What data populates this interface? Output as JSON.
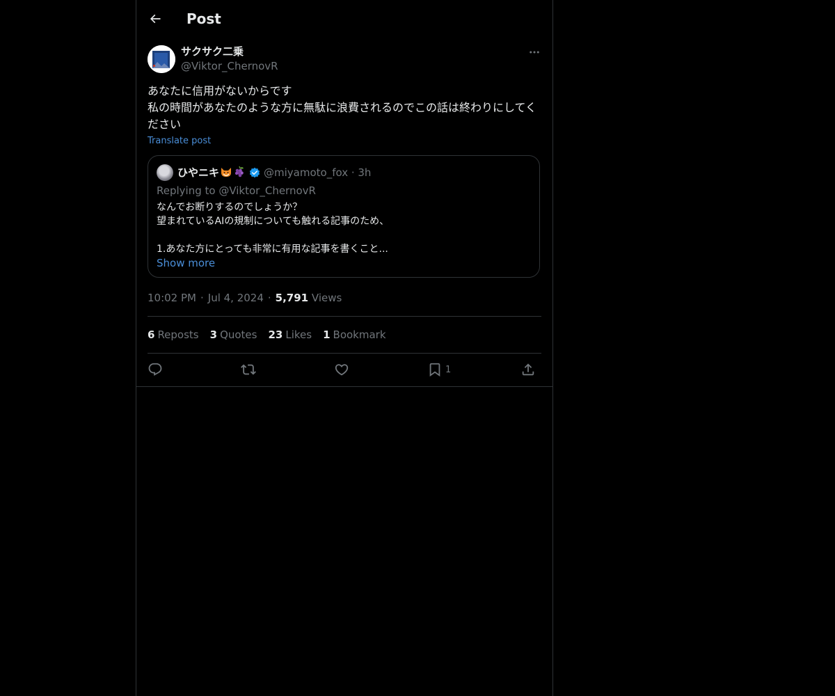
{
  "header": {
    "title": "Post"
  },
  "post": {
    "author_name": "サクサク二乗",
    "author_handle": "@Viktor_ChernovR",
    "text": "あなたに信用がないからです\n私の時間があなたのような方に無駄に浪費されるのでこの話は終わりにしてください",
    "translate_label": "Translate post",
    "time": "10:02 PM",
    "date": "Jul 4, 2024",
    "views_count": "5,791",
    "views_label": "Views"
  },
  "quote": {
    "author_name": "ひやニキ",
    "author_handle": "@miyamoto_fox",
    "age": "3h",
    "replying_to": "Replying to @Viktor_ChernovR",
    "text": "なんでお断りするのでしょうか？\n望まれているAIの規制についても触れる記事のため、\n\n1.あなた方にとっても非常に有用な記事を書くこと...",
    "show_more_label": "Show more",
    "verified": true,
    "emoji_icons": [
      "fox-icon",
      "grapes-icon"
    ]
  },
  "stats": {
    "reposts_count": "6",
    "reposts_label": "Reposts",
    "quotes_count": "3",
    "quotes_label": "Quotes",
    "likes_count": "23",
    "likes_label": "Likes",
    "bookmarks_count": "1",
    "bookmarks_label": "Bookmark"
  },
  "actions": {
    "bookmark_count": "1",
    "icons": [
      "reply-icon",
      "repost-icon",
      "like-icon",
      "bookmark-icon",
      "share-icon"
    ]
  },
  "colors": {
    "background": "#000000",
    "text": "#e7e9ea",
    "muted": "#71767b",
    "link": "#4a8ed8",
    "border": "#2f3336",
    "verified": "#1d9bf0"
  }
}
